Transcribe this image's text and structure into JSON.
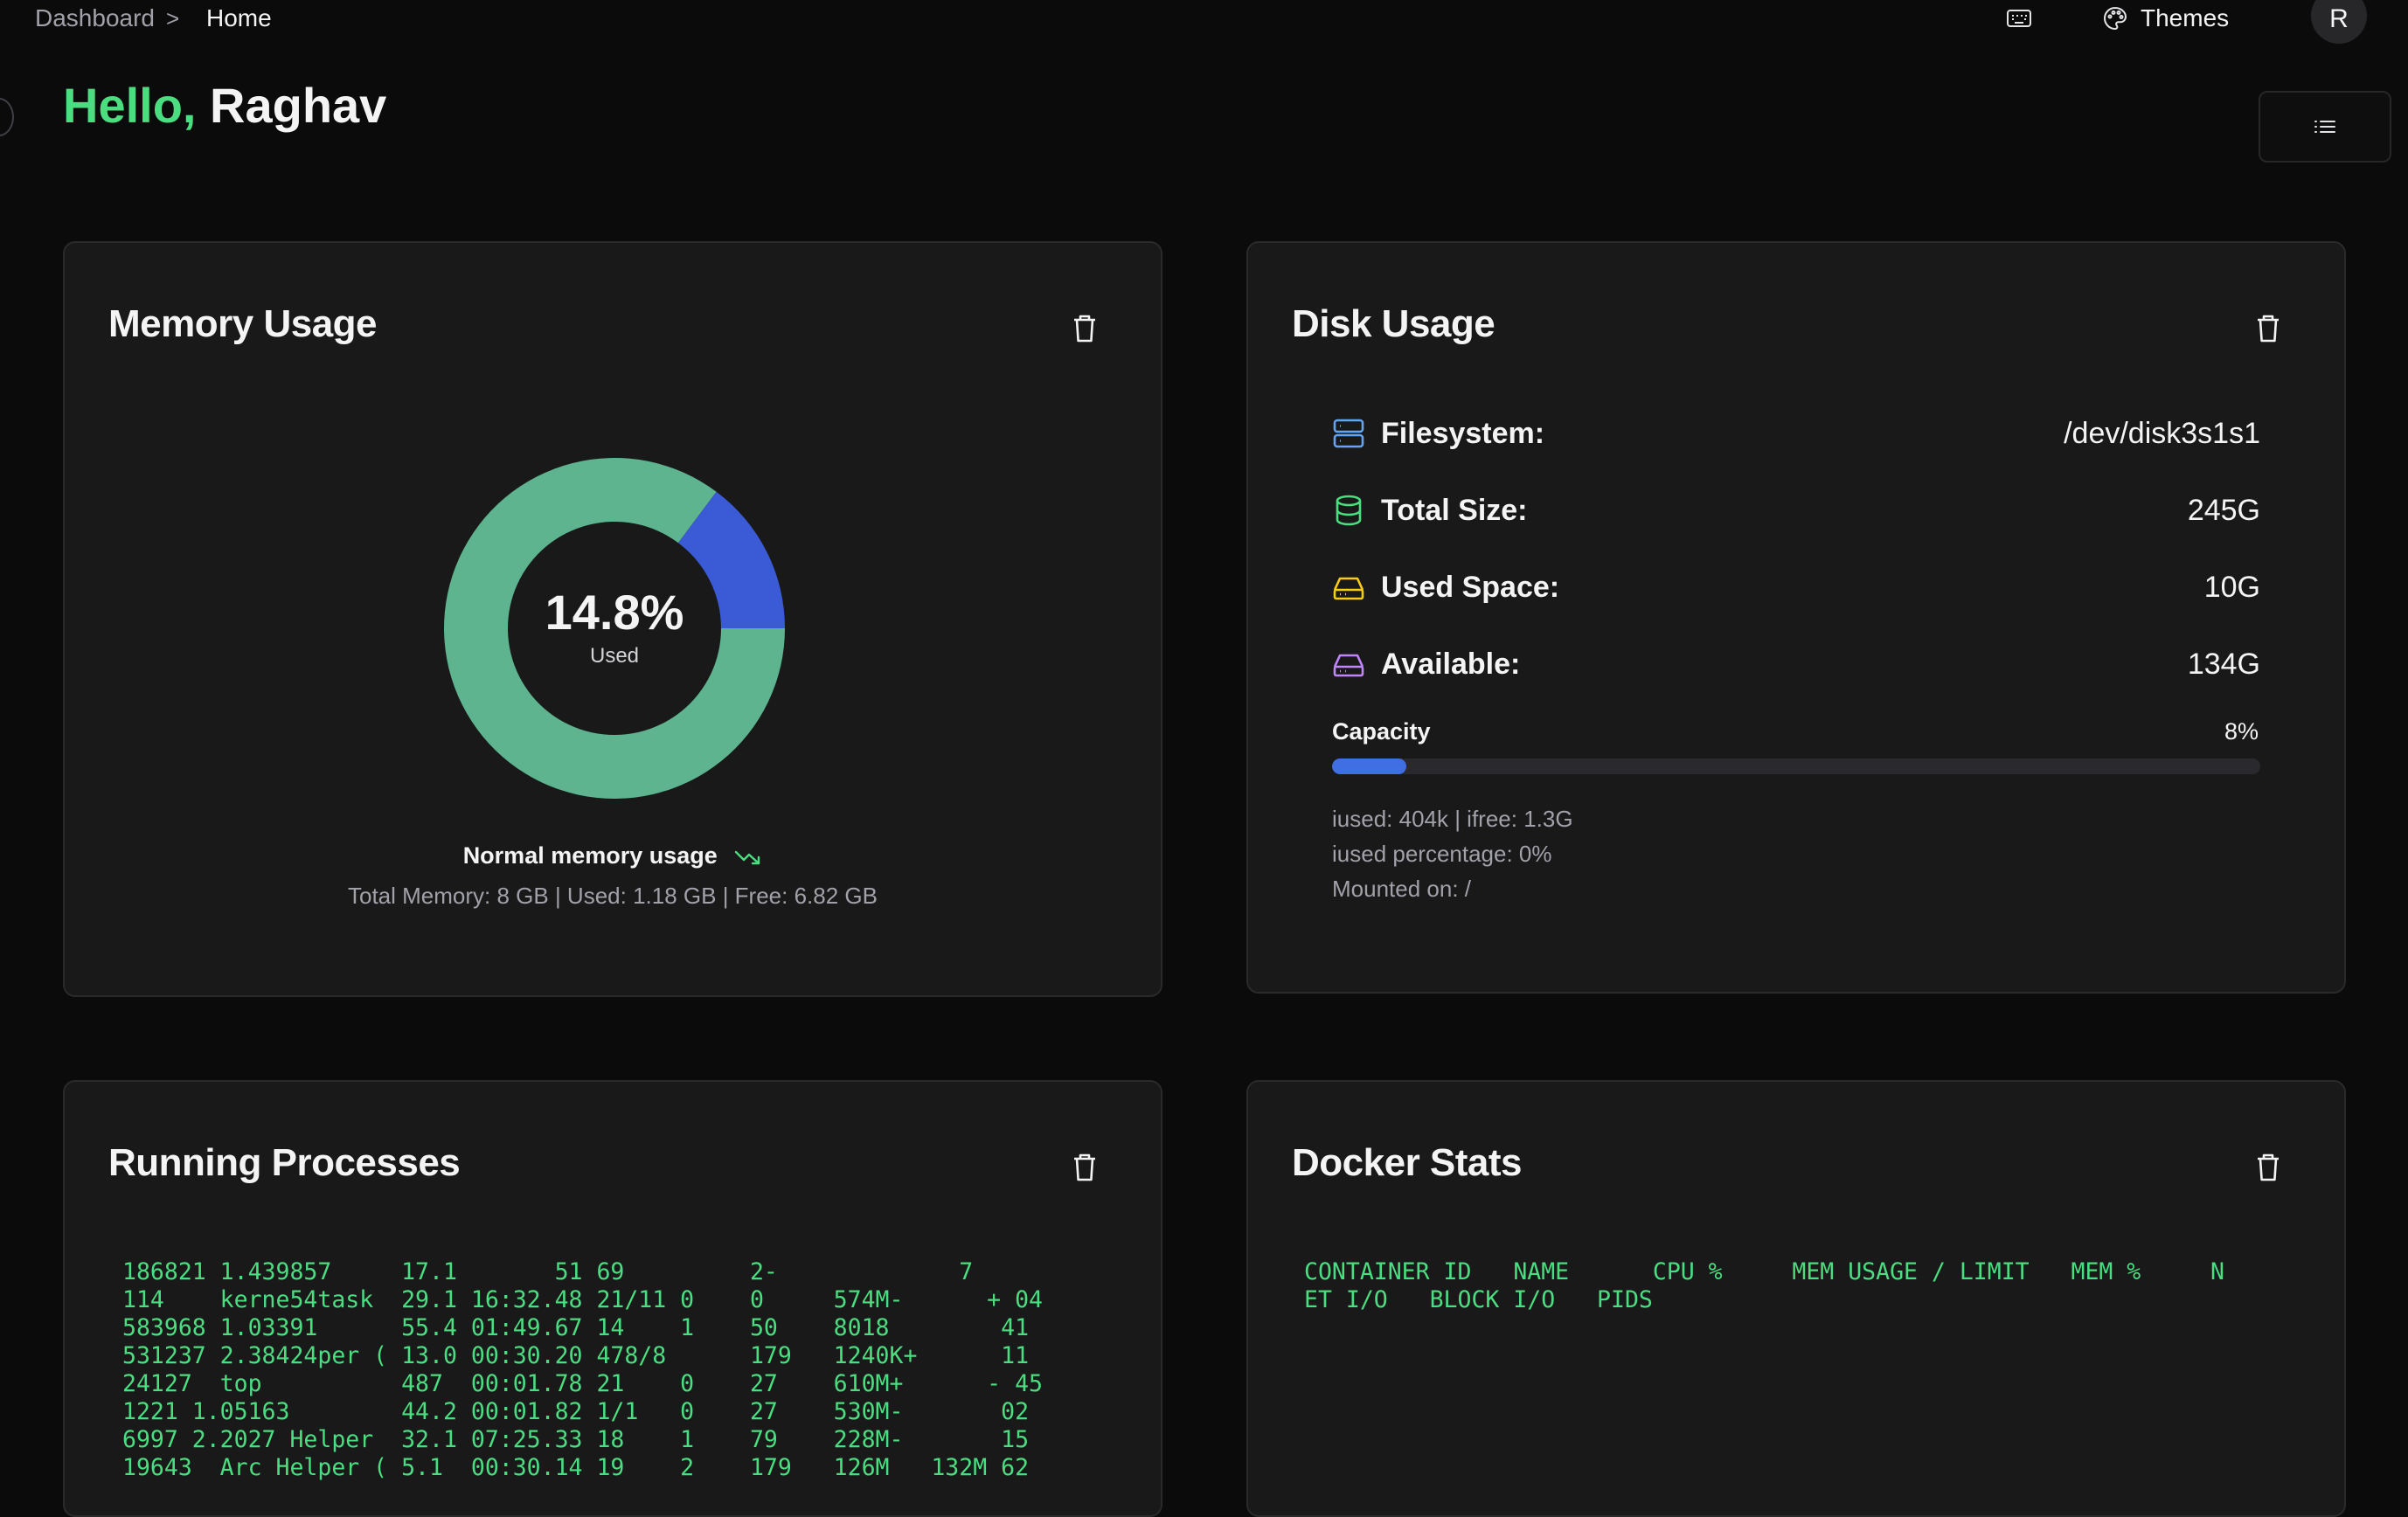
{
  "breadcrumb": {
    "items": [
      "Dashboard",
      "Home"
    ],
    "separator": ">"
  },
  "header": {
    "themes_label": "Themes",
    "avatar_initial": "R"
  },
  "greeting": {
    "hello": "Hello,",
    "name": "Raghav"
  },
  "colors": {
    "accent": "#4ade80",
    "donut_free": "#5db48f",
    "donut_used": "#3b5bd6",
    "capacity_fill": "#3f6fe3"
  },
  "memory": {
    "title": "Memory Usage",
    "used_percent": 14.8,
    "used_percent_label": "14.8%",
    "center_sublabel": "Used",
    "status": "Normal memory usage",
    "detail": "Total Memory: 8 GB | Used: 1.18 GB | Free: 6.82 GB"
  },
  "disk": {
    "title": "Disk Usage",
    "rows": [
      {
        "label": "Filesystem:",
        "value": "/dev/disk3s1s1",
        "icon": "server-icon",
        "color": "#60a5fa"
      },
      {
        "label": "Total Size:",
        "value": "245G",
        "icon": "database-icon",
        "color": "#4ade80"
      },
      {
        "label": "Used Space:",
        "value": "10G",
        "icon": "hard-drive-icon",
        "color": "#facc15"
      },
      {
        "label": "Available:",
        "value": "134G",
        "icon": "hard-drive-icon",
        "color": "#c084fc"
      }
    ],
    "capacity_label": "Capacity",
    "capacity_pct_label": "8%",
    "capacity_fraction": 0.08,
    "notes": [
      "iused: 404k | ifree: 1.3G",
      "iused percentage: 0%",
      "Mounted on: /"
    ]
  },
  "processes": {
    "title": "Running Processes",
    "lines": [
      "186821 1.439857     17.1       51 69         2-             7",
      "114    kerne54task  29.1 16:32.48 21/11 0    0     574M-      + 04",
      "583968 1.03391      55.4 01:49.67 14    1    50    8018        41",
      "531237 2.38424per ( 13.0 00:30.20 478/8      179   1240K+      11",
      "24127  top          487  00:01.78 21    0    27    610M+      - 45",
      "1221 1.05163        44.2 00:01.82 1/1   0    27    530M-       02",
      "6997 2.2027 Helper  32.1 07:25.33 18    1    79    228M-       15",
      "19643  Arc Helper ( 5.1  00:30.14 19    2    179   126M   132M 62"
    ]
  },
  "docker": {
    "title": "Docker Stats",
    "lines": [
      "CONTAINER ID   NAME      CPU %     MEM USAGE / LIMIT   MEM %     N",
      "ET I/O   BLOCK I/O   PIDS"
    ]
  }
}
